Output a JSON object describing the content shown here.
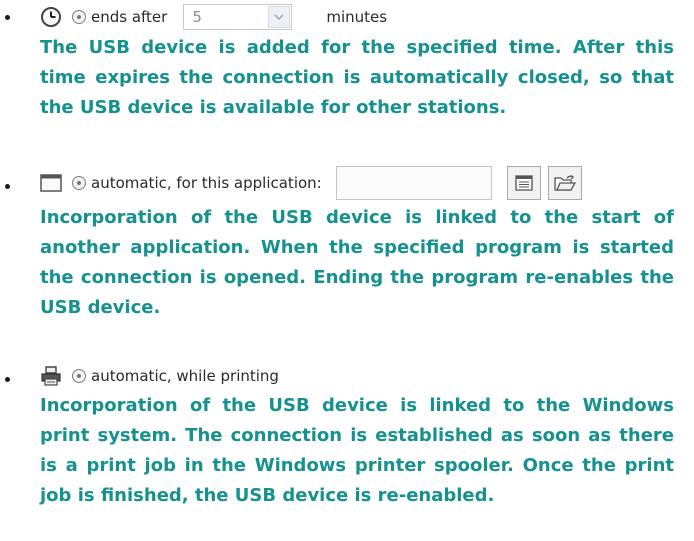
{
  "items": [
    {
      "icon": "clock-icon",
      "option_label": "ends after",
      "duration_value": "5",
      "unit_label": "minutes",
      "description": "The USB device is added for the specified time. After this time expires the connection is automatically closed, so that the USB device is available for other stations."
    },
    {
      "icon": "application-window-icon",
      "option_label": "automatic, for this application:",
      "application_value": "",
      "description": "Incorporation of the USB device is linked to the start of another application. When the specified program is started the connection is opened. Ending the program re-enables the USB device."
    },
    {
      "icon": "printer-icon",
      "option_label": "automatic, while printing",
      "description": "Incorporation of the USB device is linked to the Windows print system. The connection is established as soon as there is a print job in the Windows printer spooler. Once the print job is finished, the USB device is re-enabled."
    }
  ],
  "colors": {
    "text": "#15918f",
    "ui_text": "#2a2a2a",
    "ui_muted": "#8b8b8b"
  }
}
